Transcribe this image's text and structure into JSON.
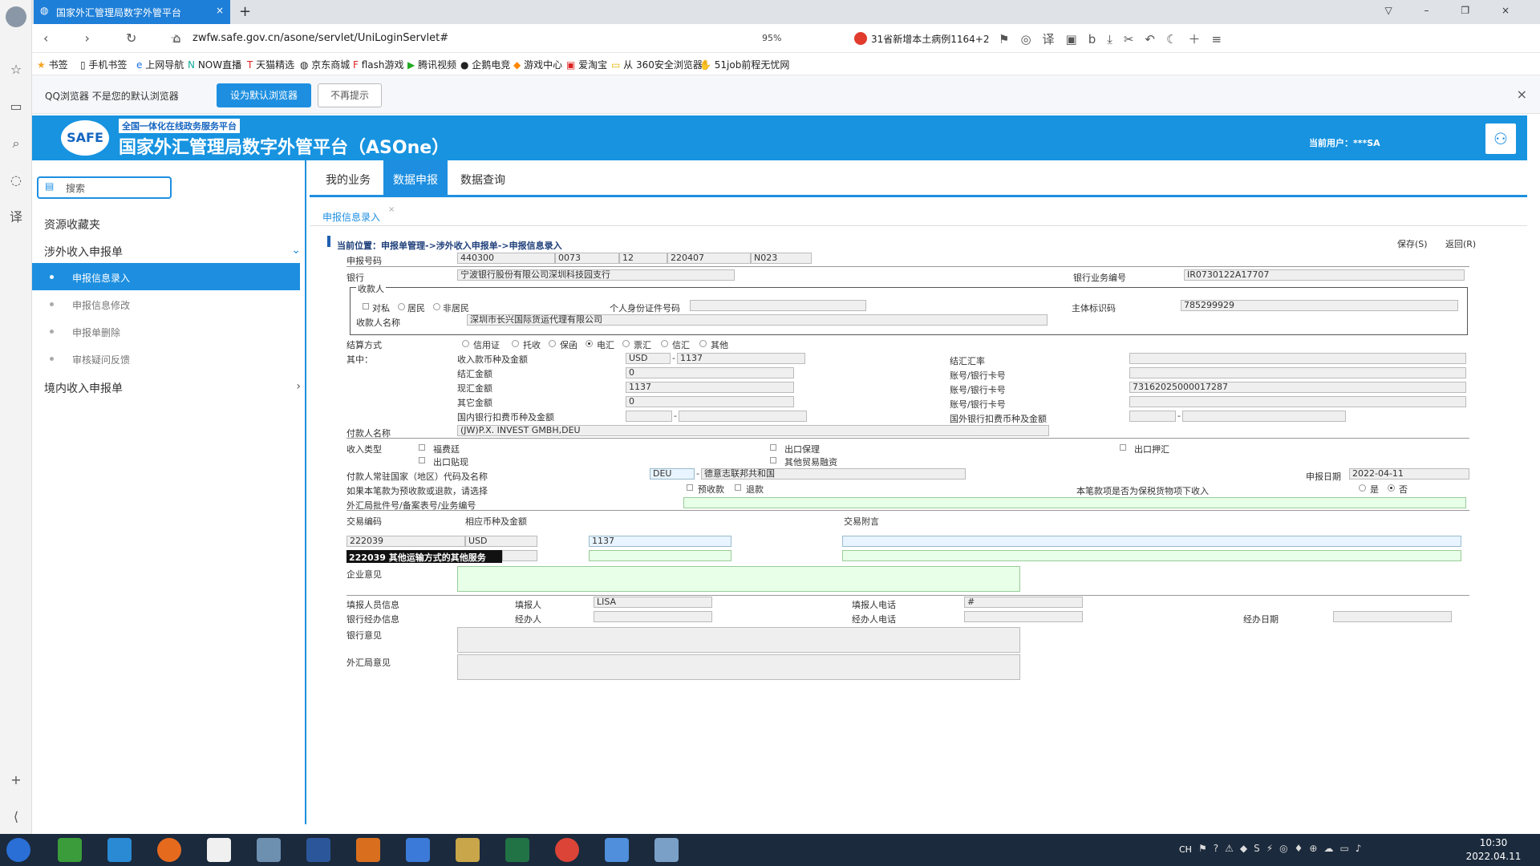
{
  "browser": {
    "tab_title": "国家外汇管理局数字外管平台",
    "url": "zwfw.safe.gov.cn/asone/servlet/UniLoginServlet#",
    "zoom": "95%",
    "news": "31省新增本土病例1164+2",
    "bookmarks": [
      "书签",
      "手机书签",
      "上网导航",
      "NOW直播",
      "天猫精选",
      "京东商城",
      "flash游戏",
      "腾讯视频",
      "企鹅电竞",
      "游戏中心",
      "爱淘宝",
      "从 360安全浏览器",
      "51job前程无忧网"
    ],
    "notice_text": "QQ浏览器 不是您的默认浏览器",
    "notice_set_default": "设为默认浏览器",
    "notice_dismiss": "不再提示"
  },
  "banner": {
    "logo": "SAFE",
    "subtitle": "全国一体化在线政务服务平台",
    "title": "国家外汇管理局数字外管平台（ASOne）",
    "user": "当前用户：***SA"
  },
  "sidebar": {
    "search": "搜索",
    "favorites": "资源收藏夹",
    "group1": "涉外收入申报单",
    "items": [
      "申报信息录入",
      "申报信息修改",
      "申报单删除",
      "审核疑问反馈"
    ],
    "group2": "境内收入申报单"
  },
  "tabs": [
    "我的业务",
    "数据申报",
    "数据查询"
  ],
  "subtab": "申报信息录入",
  "form": {
    "breadcrumb": "当前位置：申报单管理->涉外收入申报单->申报信息录入",
    "save": "保存(S)",
    "back": "返回(R)",
    "report_no_label": "申报号码",
    "report_no": [
      "440300",
      "0073",
      "12",
      "220407",
      "N023"
    ],
    "bank_label": "银行",
    "bank": "宁波银行股份有限公司深圳科技园支行",
    "bank_biz_label": "银行业务编号",
    "bank_biz": "IR0730122A17707",
    "payee_group": "收款人",
    "payee_types": [
      "对私",
      "居民",
      "非居民"
    ],
    "id_label": "个人身份证件号码",
    "entity_label": "主体标识码",
    "entity": "785299929",
    "payee_name_label": "收款人名称",
    "payee_name": "深圳市长兴国际货运代理有限公司",
    "settle_label": "结算方式",
    "settle_options": [
      "信用证",
      "托收",
      "保函",
      "电汇",
      "票汇",
      "信汇",
      "其他"
    ],
    "of_which": "其中：",
    "recv_ccy_label": "收入款币种及金额",
    "recv_ccy": "USD",
    "recv_amt": "1137",
    "fx_rate_label": "结汇汇率",
    "settle_amt_label": "结汇金额",
    "settle_amt": "0",
    "acct1_label": "账号/银行卡号",
    "spot_amt_label": "现汇金额",
    "spot_amt": "1137",
    "acct2_label": "账号/银行卡号",
    "acct2": "73162025000017287",
    "other_amt_label": "其它金额",
    "other_amt": "0",
    "acct3_label": "账号/银行卡号",
    "dom_fee_label": "国内银行扣费币种及金额",
    "for_fee_label": "国外银行扣费币种及金额",
    "payer_label": "付款人名称",
    "payer": "(JW)P.X. INVEST GMBH,DEU",
    "income_type_label": "收入类型",
    "income_types": [
      "福费廷",
      "出口保理",
      "出口押汇",
      "出口贴现",
      "其他贸易融资"
    ],
    "country_label": "付款人常驻国家（地区）代码及名称",
    "country_code": "DEU",
    "country_name": "德意志联邦共和国",
    "date_label": "申报日期",
    "date": "2022-04-11",
    "prepay_label": "如果本笔款为预收款或退款，请选择",
    "prepay_opts": [
      "预收款",
      "退款"
    ],
    "bonded_label": "本笔款项是否为保税货物项下收入",
    "bonded_yes": "是",
    "bonded_no": "否",
    "approval_label": "外汇局批件号/备案表号/业务编号",
    "tx_code_label": "交易编码",
    "tx_ccy_label": "相应币种及金额",
    "tx_note_label": "交易附言",
    "tx_code": "222039",
    "tx_ccy": "USD",
    "tx_amt": "1137",
    "tx_code_desc": "222039 其他运输方式的其他服务",
    "corp_opinion_label": "企业意见",
    "filler_info_label": "填报人员信息",
    "filler_label": "填报人",
    "filler": "LISA",
    "filler_tel_label": "填报人电话",
    "filler_tel": "#",
    "bank_staff_label": "银行经办信息",
    "handler_label": "经办人",
    "handler_tel_label": "经办人电话",
    "handle_date_label": "经办日期",
    "bank_opinion_label": "银行意见",
    "safe_opinion_label": "外汇局意见"
  },
  "taskbar": {
    "time": "10:30",
    "date": "2022.04.11",
    "lang": "CH"
  }
}
